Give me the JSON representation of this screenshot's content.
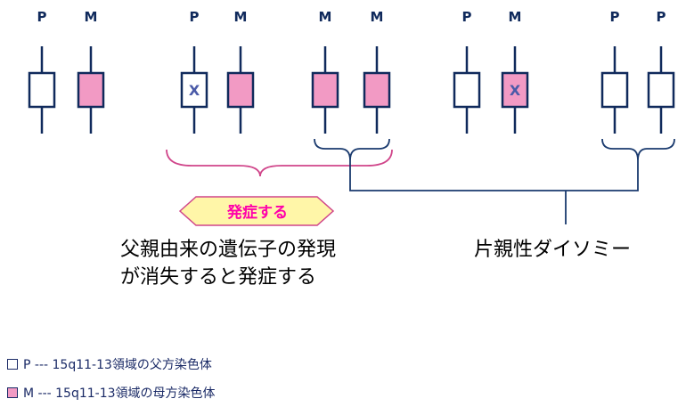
{
  "colors": {
    "paternal": "#ffffff",
    "maternal": "#f29ac4",
    "outline": "#102a5c",
    "brace_pink": "#d0458a",
    "brace_navy": "#1a3a6e",
    "badge_fill": "#fff6a8",
    "badge_border": "#d0458a",
    "badge_text": "#ff00aa"
  },
  "chromosomes": [
    {
      "label": "P",
      "type": "paternal",
      "mark": ""
    },
    {
      "label": "M",
      "type": "maternal",
      "mark": ""
    },
    {
      "label": "P",
      "type": "paternal",
      "mark": "X"
    },
    {
      "label": "M",
      "type": "maternal",
      "mark": ""
    },
    {
      "label": "M",
      "type": "maternal",
      "mark": ""
    },
    {
      "label": "M",
      "type": "maternal",
      "mark": ""
    },
    {
      "label": "P",
      "type": "paternal",
      "mark": ""
    },
    {
      "label": "M",
      "type": "maternal",
      "mark": "X"
    },
    {
      "label": "P",
      "type": "paternal",
      "mark": ""
    },
    {
      "label": "P",
      "type": "paternal",
      "mark": ""
    }
  ],
  "badge": {
    "text": "発症する"
  },
  "caption_left": {
    "line1": "父親由来の遺伝子の発現",
    "line2": "が消失すると発症する"
  },
  "caption_right": {
    "text": "片親性ダイソミー"
  },
  "legend": [
    {
      "symbol": "□",
      "text": "P --- 15q11-13領域の父方染色体",
      "type": "paternal"
    },
    {
      "symbol": "■",
      "text": "M --- 15q11-13領域の母方染色体",
      "type": "maternal"
    }
  ]
}
